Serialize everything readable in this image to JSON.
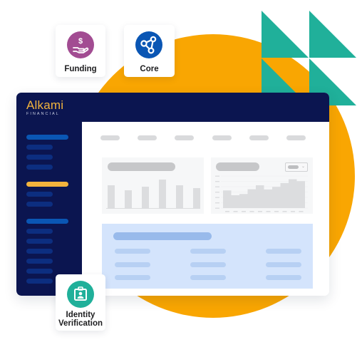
{
  "brand": {
    "name": "Alkami",
    "tagline": "FINANCIAL",
    "logo_color": "#F2B33D"
  },
  "colors": {
    "navy": "#0B1550",
    "orange_circle": "#F9A602",
    "teal": "#20B09A",
    "funding_purple": "#A24C92",
    "core_blue": "#0A56B4",
    "panel_blue": "#D4E4FC"
  },
  "badges": [
    {
      "label": "Funding",
      "icon": "hand-dollar-icon"
    },
    {
      "label": "Core",
      "icon": "network-nodes-icon"
    },
    {
      "label": "Identity\nVerification",
      "label_line1": "Identity",
      "label_line2": "Verification",
      "icon": "id-badge-icon"
    }
  ],
  "sidebar": {
    "groups": [
      {
        "active_color": "#0A56B4",
        "items": 4
      },
      {
        "active_color": "#F2B33D",
        "items": 3
      },
      {
        "active_color": "#0A56B4",
        "items": 7
      }
    ]
  },
  "main": {
    "nav_items": 6,
    "bar_card": {
      "bars": [
        0.72,
        0.56,
        0.67,
        0.88,
        0.72,
        0.62
      ]
    },
    "area_card": {
      "steps": [
        0.55,
        0.4,
        0.44,
        0.59,
        0.71,
        0.58,
        0.66,
        0.78,
        0.9,
        0.84
      ],
      "dropdown": "chevron-down-icon"
    },
    "table": {
      "rows": 3,
      "cols": 3
    }
  }
}
